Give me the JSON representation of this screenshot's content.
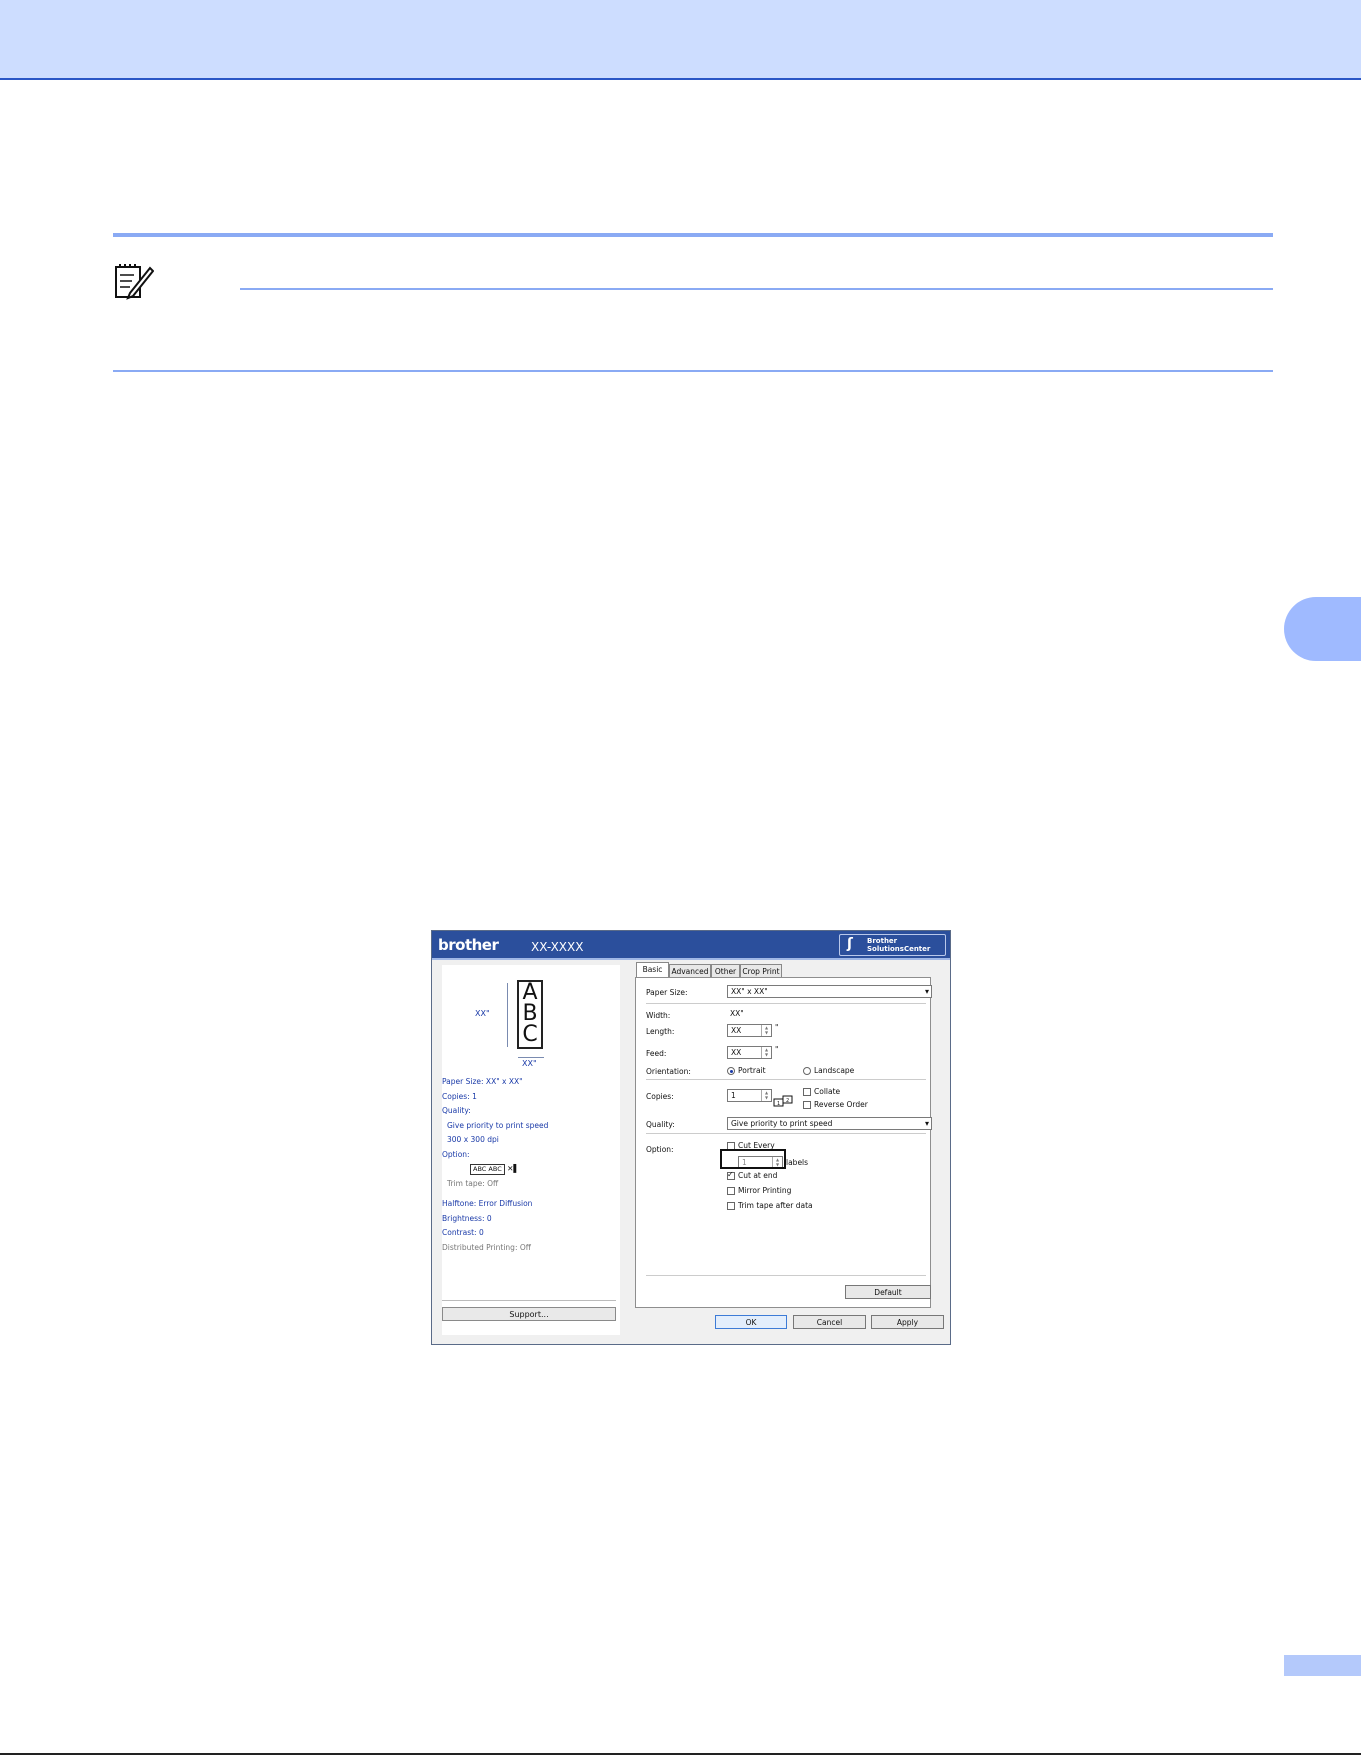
{
  "icons": {
    "note": "pencil-note-icon"
  },
  "dialog": {
    "logo": "brother",
    "model": "XX-XXXX",
    "solutions_center": {
      "line1": "Brother",
      "line2": "SolutionsCenter"
    },
    "preview": {
      "letters": "ABC",
      "height_label": "XX\"",
      "width_label": "XX\""
    },
    "summary": {
      "paper_size": "Paper Size:   XX\" x XX\"",
      "copies": "Copies: 1",
      "quality": "Quality:",
      "quality_value": "Give priority to print speed",
      "resolution": "300 x 300 dpi",
      "option": "Option:",
      "option_sample": "ABC ABC",
      "trim_tape": "Trim tape: Off",
      "halftone": "Halftone: Error Diffusion",
      "brightness": "Brightness:   0",
      "contrast": "Contrast:   0",
      "distributed": "Distributed Printing: Off"
    },
    "support_button": "Support...",
    "tabs": [
      "Basic",
      "Advanced",
      "Other",
      "Crop Print"
    ],
    "basic": {
      "paper_size_label": "Paper Size:",
      "paper_size_value": "XX\" x XX\"",
      "width_label": "Width:",
      "width_value": "XX\"",
      "length_label": "Length:",
      "length_value": "XX",
      "feed_label": "Feed:",
      "feed_value": "XX",
      "unit_mark": "\"",
      "orientation_label": "Orientation:",
      "portrait": "Portrait",
      "landscape": "Landscape",
      "copies_label": "Copies:",
      "copies_value": "1",
      "collate": "Collate",
      "reverse_order": "Reverse Order",
      "quality_label": "Quality:",
      "quality_value": "Give priority to print speed",
      "option_label": "Option:",
      "cut_every": "Cut Every",
      "cut_every_value": "1",
      "labels": "labels",
      "cut_at_end": "Cut at end",
      "mirror_printing": "Mirror Printing",
      "trim_tape": "Trim tape after data",
      "default_button": "Default"
    },
    "buttons": {
      "ok": "OK",
      "cancel": "Cancel",
      "apply": "Apply"
    }
  }
}
